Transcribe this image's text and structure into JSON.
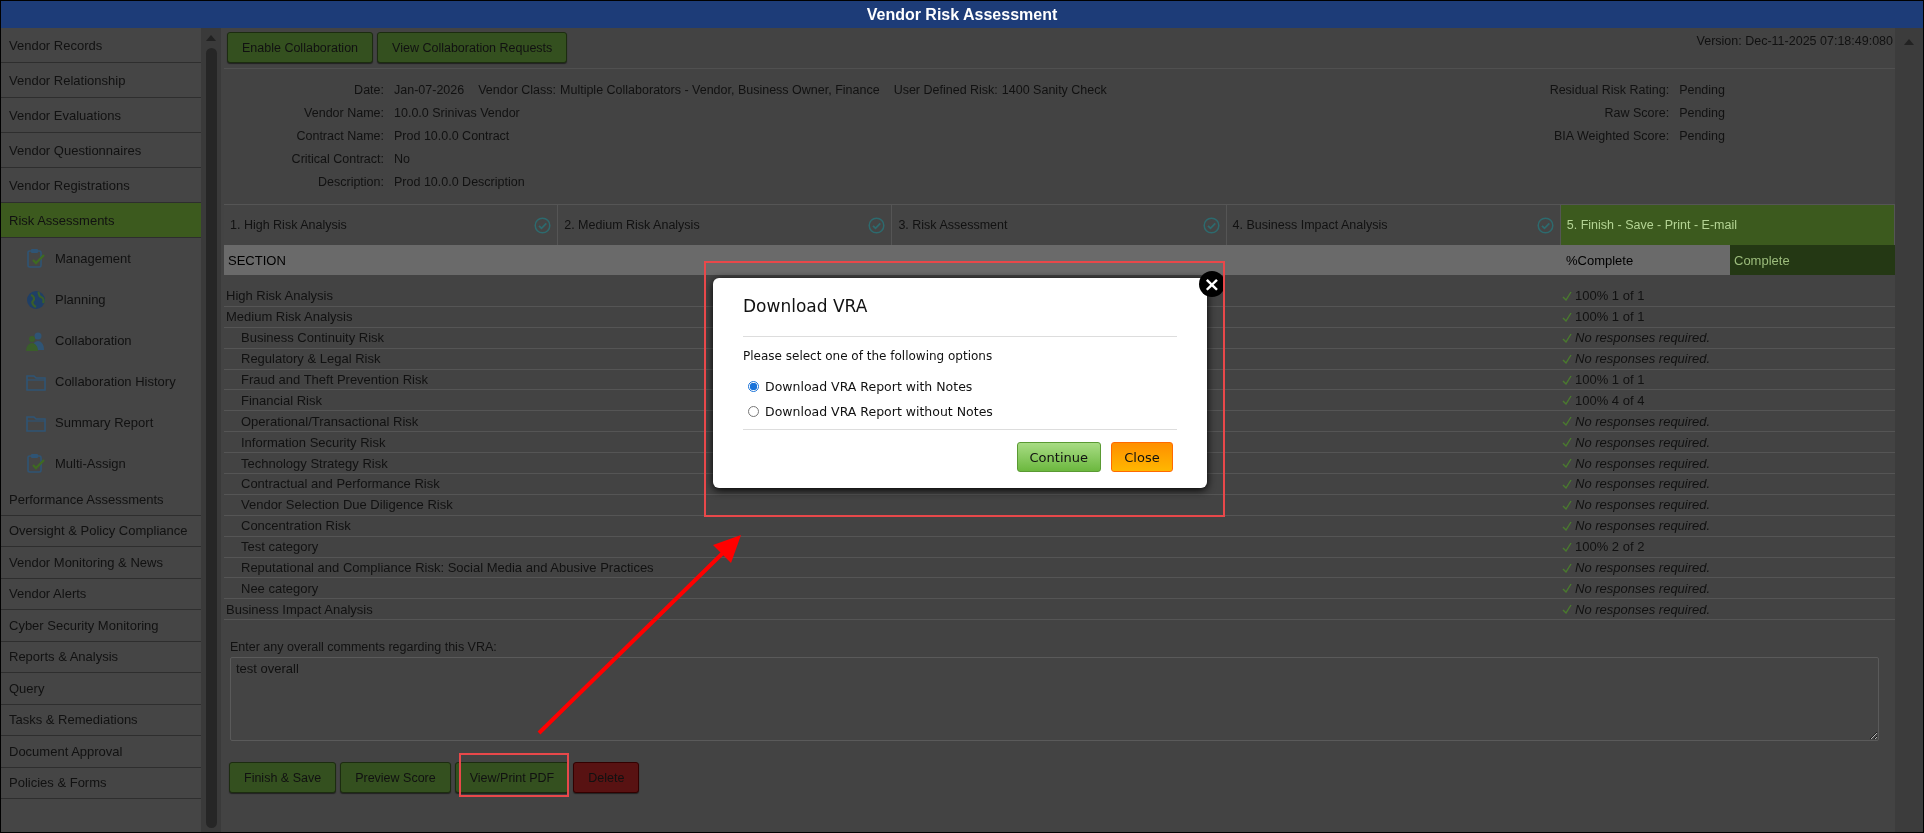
{
  "window": {
    "title": "Vendor Risk Assessment"
  },
  "sidebar": {
    "items": [
      {
        "label": "Vendor Records",
        "selected": false
      },
      {
        "label": "Vendor Relationship",
        "selected": false
      },
      {
        "label": "Vendor Evaluations",
        "selected": false
      },
      {
        "label": "Vendor Questionnaires",
        "selected": false
      },
      {
        "label": "Vendor Registrations",
        "selected": false
      },
      {
        "label": "Risk Assessments",
        "selected": true,
        "children": [
          {
            "label": "Management",
            "kind": "clipboard"
          },
          {
            "label": "Planning",
            "kind": "globe"
          },
          {
            "label": "Collaboration",
            "kind": "people"
          },
          {
            "label": "Collaboration History",
            "kind": "folder"
          },
          {
            "label": "Summary Report",
            "kind": "folder"
          },
          {
            "label": "Multi-Assign",
            "kind": "clipboard"
          }
        ]
      },
      {
        "label": "Performance Assessments",
        "selected": false
      },
      {
        "label": "Oversight & Policy Compliance",
        "selected": false
      },
      {
        "label": "Vendor Monitoring & News",
        "selected": false
      },
      {
        "label": "Vendor Alerts",
        "selected": false
      },
      {
        "label": "Cyber Security Monitoring",
        "selected": false
      },
      {
        "label": "Reports & Analysis",
        "selected": false
      },
      {
        "label": "Query",
        "selected": false
      },
      {
        "label": "Tasks & Remediations",
        "selected": false
      },
      {
        "label": "Document Approval",
        "selected": false
      },
      {
        "label": "Policies & Forms",
        "selected": false
      }
    ]
  },
  "toolbar": {
    "buttons": [
      "Enable Collaboration",
      "View Collaboration Requests"
    ],
    "version": "Version: Dec-11-2025 07:18:49:080"
  },
  "details": {
    "left": [
      {
        "label": "Date:",
        "value": "Jan-07-2026"
      },
      {
        "label": "Vendor Name:",
        "value": "10.0.0 Srinivas Vendor"
      },
      {
        "label": "Contract Name:",
        "value": "Prod 10.0.0 Contract"
      },
      {
        "label": "Critical Contract:",
        "value": "No"
      },
      {
        "label": "Description:",
        "value": "Prod 10.0.0 Description"
      }
    ],
    "inline": [
      {
        "label": "Vendor Class:",
        "value": "Multiple Collaborators - Vendor, Business Owner, Finance"
      },
      {
        "label": "User Defined Risk:",
        "value": "1400 Sanity Check"
      }
    ],
    "right": [
      {
        "label": "Residual Risk Rating:",
        "value": "Pending"
      },
      {
        "label": "Raw Score:",
        "value": "Pending"
      },
      {
        "label": "BIA Weighted Score:",
        "value": "Pending"
      }
    ]
  },
  "steps": [
    {
      "label": "1. High Risk Analysis",
      "done": true,
      "selected": false
    },
    {
      "label": "2. Medium Risk Analysis",
      "done": true,
      "selected": false
    },
    {
      "label": "3. Risk Assessment",
      "done": true,
      "selected": false
    },
    {
      "label": "4. Business Impact Analysis",
      "done": true,
      "selected": false
    },
    {
      "label": "5. Finish - Save - Print - E-mail",
      "done": false,
      "selected": true
    }
  ],
  "table": {
    "columns": [
      "SECTION",
      "%Complete",
      "Complete"
    ],
    "rows": [
      {
        "section": "High Risk Analysis",
        "complete": "100% 1 of 1",
        "kind": "count"
      },
      {
        "section": "Medium Risk Analysis",
        "complete": "100% 1 of 1",
        "kind": "count",
        "children": [
          {
            "section": "Business Continuity Risk",
            "complete": "No responses required.",
            "kind": "none"
          },
          {
            "section": "Regulatory & Legal Risk",
            "complete": "No responses required.",
            "kind": "none"
          },
          {
            "section": "Fraud and Theft Prevention Risk",
            "complete": "100% 1 of 1",
            "kind": "count"
          },
          {
            "section": "Financial Risk",
            "complete": "100% 4 of 4",
            "kind": "count"
          },
          {
            "section": "Operational/Transactional Risk",
            "complete": "No responses required.",
            "kind": "none"
          },
          {
            "section": "Information Security Risk",
            "complete": "No responses required.",
            "kind": "none"
          },
          {
            "section": "Technology Strategy Risk",
            "complete": "No responses required.",
            "kind": "none"
          },
          {
            "section": "Contractual and Performance Risk",
            "complete": "No responses required.",
            "kind": "none"
          },
          {
            "section": "Vendor Selection Due Diligence Risk",
            "complete": "No responses required.",
            "kind": "none"
          },
          {
            "section": "Concentration Risk",
            "complete": "No responses required.",
            "kind": "none"
          },
          {
            "section": "Test category",
            "complete": "100% 2 of 2",
            "kind": "count"
          },
          {
            "section": "Reputational and Compliance Risk:  Social Media and Abusive Practices",
            "complete": "No responses required.",
            "kind": "none"
          },
          {
            "section": "Nee category",
            "complete": "No responses required.",
            "kind": "none"
          }
        ]
      },
      {
        "section": "Business Impact Analysis",
        "complete": "No responses required.",
        "kind": "none"
      }
    ]
  },
  "comments": {
    "label": "Enter any overall comments regarding this VRA:",
    "value": "test overall"
  },
  "actions": [
    {
      "label": "Finish & Save",
      "kind": "primary"
    },
    {
      "label": "Preview Score",
      "kind": "primary"
    },
    {
      "label": "View/Print PDF",
      "kind": "primary"
    },
    {
      "label": "Delete",
      "kind": "danger"
    }
  ],
  "dialog": {
    "title": "Download VRA",
    "prompt": "Please select one of the following options",
    "options": [
      {
        "label": "Download VRA Report with Notes",
        "selected": true
      },
      {
        "label": "Download VRA Report without Notes",
        "selected": false
      }
    ],
    "buttons": [
      {
        "label": "Continue",
        "kind": "confirm"
      },
      {
        "label": "Close",
        "kind": "cancel"
      }
    ],
    "close": "×"
  }
}
